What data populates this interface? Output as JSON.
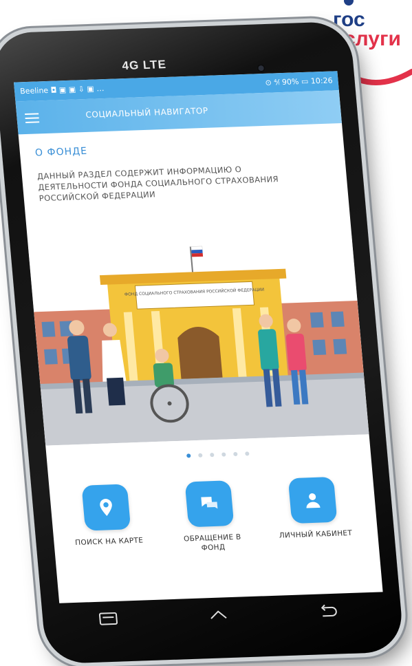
{
  "logo": {
    "line1": "гос",
    "line2": "услуги"
  },
  "phone": {
    "brand": "4G LTE"
  },
  "statusbar": {
    "left": "Beeline ◘ ▣ ▣ ⇩ ▣ …",
    "right": "⊙ ⁴⁄ₗ 90% ▭ 10:26"
  },
  "appbar": {
    "title": "СОЦИАЛЬНЫЙ НАВИГАТОР"
  },
  "content": {
    "section_title": "О ФОНДЕ",
    "description": "ДАННЫЙ РАЗДЕЛ СОДЕРЖИТ ИНФОРМАЦИЮ О ДЕЯТЕЛЬНОСТИ ФОНДА СОЦИАЛЬНОГО СТРАХОВАНИЯ РОССИЙСКОЙ ФЕДЕРАЦИИ",
    "building_sign": "ФОНД СОЦИАЛЬНОГО СТРАХОВАНИЯ РОССИЙСКОЙ ФЕДЕРАЦИИ"
  },
  "carousel": {
    "count": 6,
    "active": 0
  },
  "actions": [
    {
      "label": "ПОИСК НА КАРТЕ",
      "icon": "map-pin-icon"
    },
    {
      "label": "ОБРАЩЕНИЕ В ФОНД",
      "icon": "chat-icon"
    },
    {
      "label": "ЛИЧНЫЙ КАБИНЕТ",
      "icon": "user-icon"
    }
  ],
  "colors": {
    "accent": "#35a3ec",
    "logo_blue": "#1f3f86",
    "logo_red": "#e3324a"
  }
}
